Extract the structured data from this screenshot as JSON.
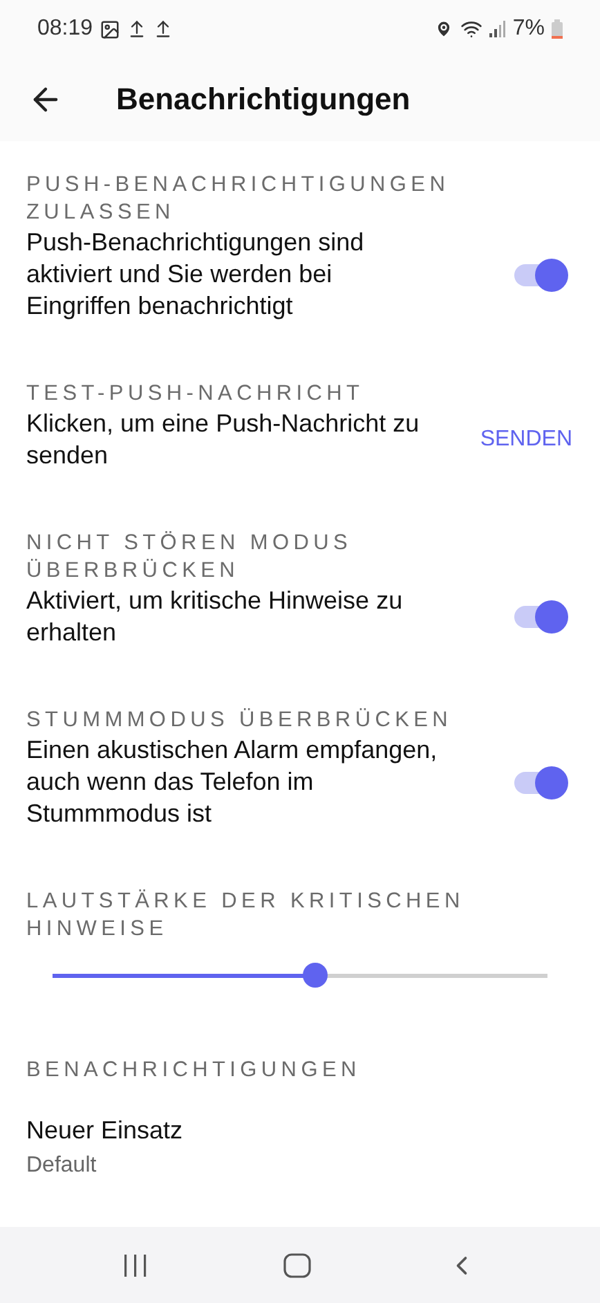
{
  "status_bar": {
    "time": "08:19",
    "battery": "7%"
  },
  "header": {
    "title": "Benachrichtigungen"
  },
  "sections": [
    {
      "kind": "toggle",
      "heading": "PUSH-BENACHRICHTIGUNGEN ZULASSEN",
      "description": "Push-Benachrichtigungen sind aktiviert und Sie werden bei Eingriffen benachrichtigt",
      "on": true
    },
    {
      "kind": "action",
      "heading": "TEST-PUSH-NACHRICHT",
      "description": "Klicken, um eine Push-Nachricht zu senden",
      "action": "SENDEN"
    },
    {
      "kind": "toggle",
      "heading": "NICHT STÖREN MODUS ÜBERBRÜCKEN",
      "description": "Aktiviert, um kritische Hinweise zu erhalten",
      "on": true
    },
    {
      "kind": "toggle",
      "heading": "STUMMMODUS ÜBERBRÜCKEN",
      "description": "Einen akustischen Alarm empfangen, auch wenn das Telefon im Stummmodus ist",
      "on": true
    },
    {
      "kind": "slider",
      "heading": "LAUTSTÄRKE DER KRITISCHEN HINWEISE",
      "level": 0.53
    },
    {
      "kind": "list",
      "heading": "BENACHRICHTIGUNGEN",
      "items": [
        {
          "title": "Neuer Einsatz",
          "subtitle": "Default"
        }
      ]
    }
  ]
}
